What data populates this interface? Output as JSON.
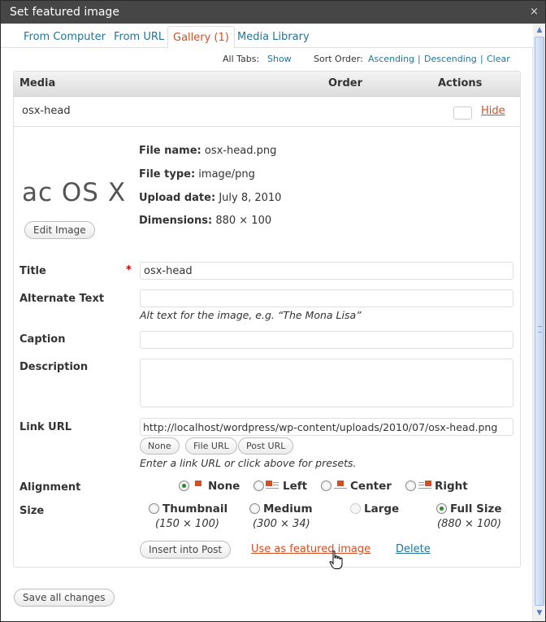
{
  "window": {
    "title": "Set featured image",
    "close_glyph": "×"
  },
  "tabs": [
    {
      "label": "From Computer",
      "active": false
    },
    {
      "label": "From URL",
      "active": false
    },
    {
      "label": "Gallery (1)",
      "active": true
    },
    {
      "label": "Media Library",
      "active": false
    }
  ],
  "sortbar": {
    "all_tabs_label": "All Tabs:",
    "show_link": "Show",
    "sort_order_label": "Sort Order:",
    "ascending": "Ascending",
    "descending": "Descending",
    "clear": "Clear",
    "separator": "|"
  },
  "media_header": {
    "media": "Media",
    "order": "Order",
    "actions": "Actions"
  },
  "item": {
    "name": "osx-head",
    "hide_link": "Hide",
    "thumbnail_text": "ac OS X",
    "edit_image_button": "Edit Image",
    "file_name_label": "File name:",
    "file_name": "osx-head.png",
    "file_type_label": "File type:",
    "file_type": "image/png",
    "upload_date_label": "Upload date:",
    "upload_date": "July 8, 2010",
    "dimensions_label": "Dimensions:",
    "dimensions": "880 × 100"
  },
  "form": {
    "title_label": "Title",
    "required_mark": "*",
    "title_value": "osx-head",
    "alt_label": "Alternate Text",
    "alt_value": "",
    "alt_help": "Alt text for the image, e.g. “The Mona Lisa”",
    "caption_label": "Caption",
    "caption_value": "",
    "description_label": "Description",
    "description_value": "",
    "link_label": "Link URL",
    "link_value": "http://localhost/wordpress/wp-content/uploads/2010/07/osx-head.png",
    "link_buttons": {
      "none": "None",
      "file_url": "File URL",
      "post_url": "Post URL"
    },
    "link_help": "Enter a link URL or click above for presets.",
    "alignment_label": "Alignment",
    "alignment_options": [
      {
        "label": "None",
        "checked": true
      },
      {
        "label": "Left",
        "checked": false
      },
      {
        "label": "Center",
        "checked": false
      },
      {
        "label": "Right",
        "checked": false
      }
    ],
    "size_label": "Size",
    "size_options": [
      {
        "label": "Thumbnail",
        "dims": "(150 × 100)",
        "checked": false,
        "disabled": false
      },
      {
        "label": "Medium",
        "dims": "(300 × 34)",
        "checked": false,
        "disabled": false
      },
      {
        "label": "Large",
        "dims": "",
        "checked": false,
        "disabled": true
      },
      {
        "label": "Full Size",
        "dims": "(880 × 100)",
        "checked": true,
        "disabled": false
      }
    ],
    "insert_button": "Insert into Post",
    "featured_link": "Use as featured image",
    "delete_link": "Delete"
  },
  "footer": {
    "save_button": "Save all changes"
  },
  "colors": {
    "link": "#21759b",
    "accent": "#d54e21",
    "titlebar": "#464646",
    "required": "#cc0000"
  }
}
